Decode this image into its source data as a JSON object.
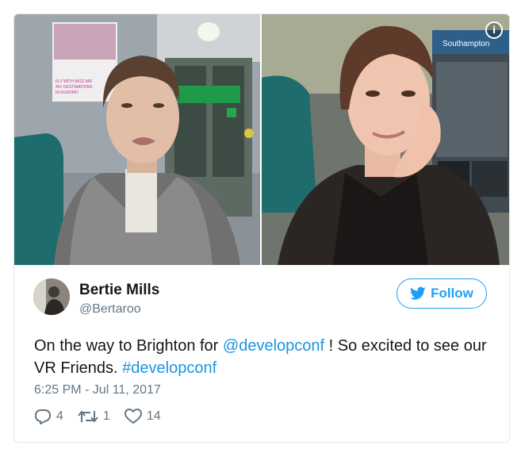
{
  "tweet": {
    "user": {
      "name": "Bertie Mills",
      "handle": "@Bertaroo"
    },
    "follow_label": "Follow",
    "text": {
      "part1": "On the way to Brighton for ",
      "mention": "@developconf",
      "part2": " ! So excited to see our VR Friends. ",
      "hashtag": "#developconf"
    },
    "timestamp": "6:25 PM - Jul 11, 2017",
    "stats": {
      "replies": "4",
      "retweets": "1",
      "likes": "14"
    }
  },
  "media": {
    "info_symbol": "i",
    "poster_text": "FLY WITH WIZZ AIR 40+ DESTINATIONS IN EUROPE!",
    "sign_text": "Southampton"
  },
  "colors": {
    "accent": "#1da1f2",
    "link": "#1b95e0",
    "muted": "#657786",
    "border": "#e1e8ed"
  },
  "icons": [
    "info-icon",
    "bird-icon",
    "reply-icon",
    "retweet-icon",
    "like-icon"
  ]
}
